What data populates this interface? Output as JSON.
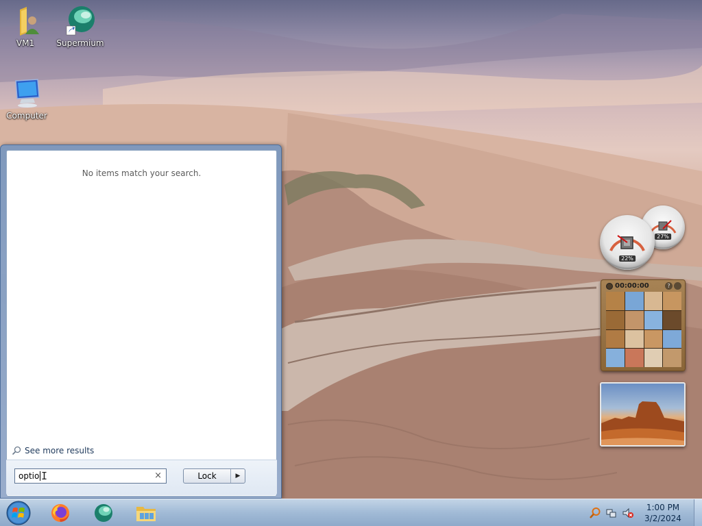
{
  "desktop": {
    "icons": [
      {
        "label": "VM1",
        "icon": "user-folder-icon"
      },
      {
        "label": "Supermium",
        "icon": "supermium-shortcut-icon"
      },
      {
        "label": "Computer",
        "icon": "computer-icon"
      }
    ]
  },
  "start_menu": {
    "no_results_text": "No items match your search.",
    "see_more_label": "See more results",
    "search_value": "optio",
    "clear_icon": "×",
    "lock_label": "Lock",
    "lock_arrow": "▶"
  },
  "gadgets": {
    "cpu_meter": {
      "cpu_percent": "22%",
      "memory_percent": "27%"
    },
    "puzzle": {
      "timer": "00:00:00"
    },
    "slideshow": {
      "subject": "desert mesa photo"
    }
  },
  "taskbar": {
    "pinned": [
      {
        "name": "firefox",
        "icon": "firefox-icon"
      },
      {
        "name": "supermium",
        "icon": "supermium-icon"
      },
      {
        "name": "explorer",
        "icon": "file-explorer-icon"
      }
    ],
    "clock_time": "1:00 PM",
    "clock_date": "3/2/2024"
  },
  "colors": {
    "taskbar": "#a8c0dc",
    "start_menu_frame": "#7f9fc7",
    "link_blue": "#1e395b"
  }
}
